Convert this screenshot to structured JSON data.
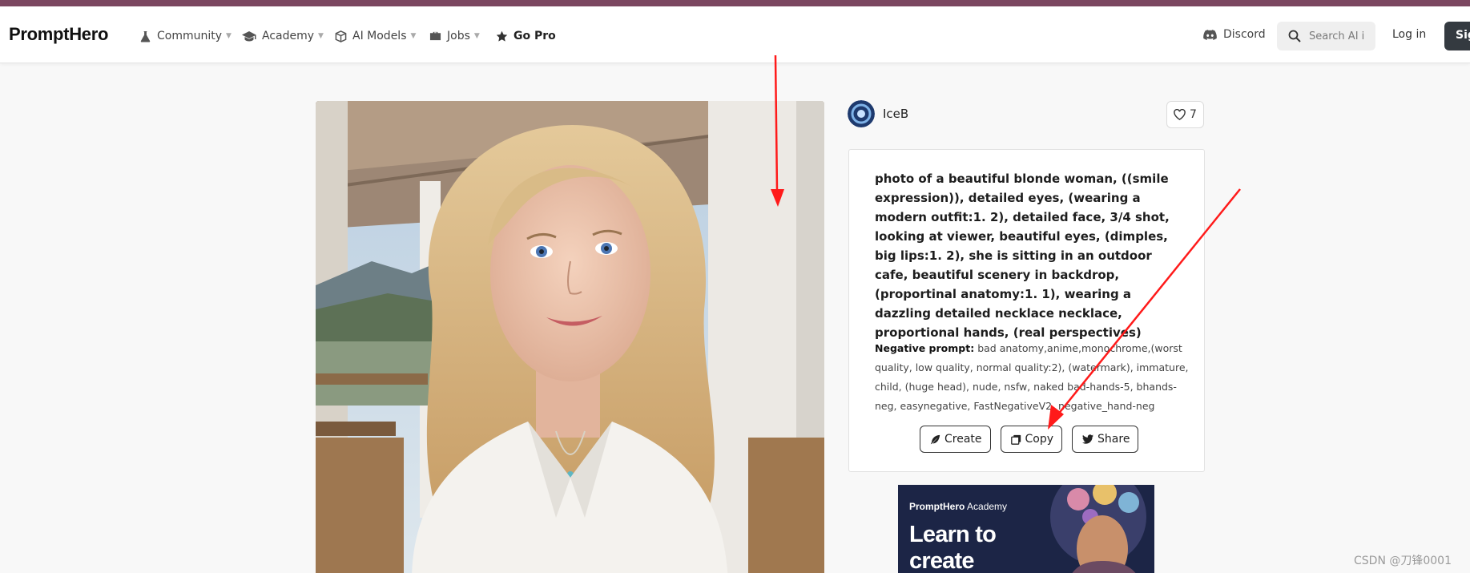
{
  "brand": "PromptHero",
  "nav": {
    "community": "Community",
    "academy": "Academy",
    "ai_models": "AI Models",
    "jobs": "Jobs",
    "go_pro": "Go Pro",
    "discord": "Discord",
    "search_placeholder": "Search AI i",
    "login": "Log in",
    "signup": "Sig"
  },
  "author": {
    "name": "IceB",
    "likes": "7"
  },
  "prompt": {
    "text": "photo of a beautiful blonde woman, ((smile expression)), detailed eyes, (wearing a modern outfit:1. 2), detailed face, 3/4 shot, looking at viewer, beautiful eyes, (dimples, big lips:1. 2), she is sitting in an outdoor cafe, beautiful scenery in backdrop, (proportinal anatomy:1. 1), wearing a dazzling detailed necklace necklace, proportional hands, (real perspectives)",
    "negative_label": "Negative prompt:",
    "negative_text": "bad anatomy,anime,monochrome,(worst quality, low quality, normal quality:2), (watermark), immature, child, (huge head), nude, nsfw, naked bad-hands-5, bhands-neg, easynegative, FastNegativeV2, negative_hand-neg"
  },
  "actions": {
    "create": "Create",
    "copy": "Copy",
    "share": "Share"
  },
  "ad": {
    "brand_bold": "PromptHero",
    "brand_rest": " Academy",
    "headline": "Learn to create breathtaking"
  },
  "watermark": "CSDN @刀锋0001",
  "colors": {
    "top_stripe": "#7b4760",
    "annotation_arrow": "#ff1a1a",
    "signup_button": "#343a40"
  }
}
